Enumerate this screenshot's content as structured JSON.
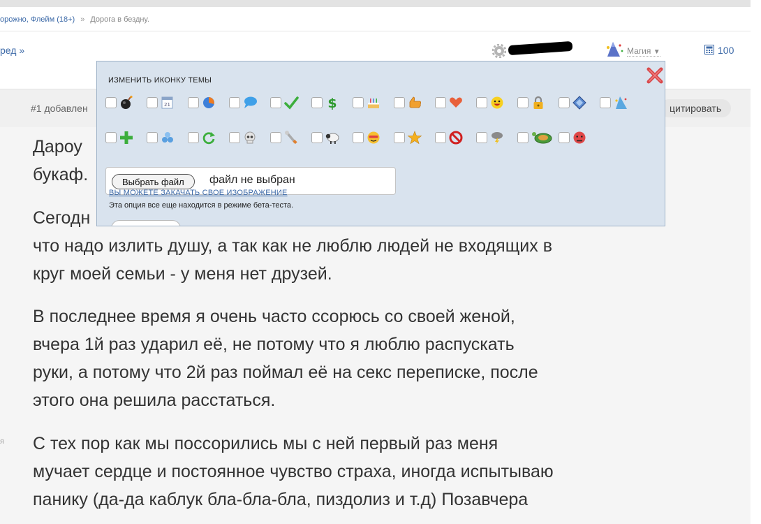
{
  "breadcrumb": {
    "section": "орожно, Флейм (18+)",
    "separator": "»",
    "current": "Дорога в бездну."
  },
  "nav": {
    "next_link": "ред »",
    "user_menu_label": "",
    "magic_label": "Магия",
    "dropdown_arrow": "▼",
    "count": "100"
  },
  "post": {
    "number_text": "#1 добавлен",
    "quote_label": "цитировать",
    "side_hint": "я"
  },
  "paragraphs": [
    {
      "lines": [
        "Дароу",
        "букаф."
      ]
    },
    {
      "lines": [
        "Сегодн",
        "что надо излить душу, а так как не люблю людей не входящих в",
        "круг моей семьи - у меня нет друзей."
      ]
    },
    {
      "lines": [
        "В последнее время я очень часто ссорюсь со своей женой,",
        "вчера 1й раз ударил её, не потому что я люблю распускать",
        "руки, а потому что 2й раз поймал её на секс переписке, после",
        "этого она решила расстаться."
      ]
    },
    {
      "lines": [
        "С тех пор как мы поссорились мы с ней первый раз меня",
        "мучает сердце и постоянное чувство страха, иногда испытываю",
        "панику (да-да каблук бла-бла-бла, пиздолиз и т.д) Позавчера"
      ]
    }
  ],
  "icon_panel": {
    "title": "ИЗМЕНИТЬ ИКОНКУ ТЕМЫ",
    "row1": [
      "bomb-icon",
      "calendar-icon",
      "pie-chart-icon",
      "speech-bubble-icon",
      "checkmark-icon",
      "dollar-icon",
      "cake-icon",
      "thumb-icon",
      "heart-icon",
      "smiley-icon",
      "padlock-icon",
      "diamond-icon",
      "sparkle-icon"
    ],
    "row2": [
      "plus-icon",
      "molecule-icon",
      "refresh-icon",
      "skull-icon",
      "wrench-icon",
      "sheep-icon",
      "cool-face-icon",
      "star-icon",
      "no-entry-icon",
      "storm-cloud-icon",
      "turtle-icon",
      "angry-face-icon"
    ],
    "file_button": "Выбрать файл",
    "file_state": "файл не выбран",
    "upload_link": "ВЫ МОЖЕТЕ ЗАКАЧАТЬ СВОЕ ИЗОБРАЖЕНИЕ",
    "beta_note": "Эта опция все еще находится в режиме бета-теста."
  },
  "colors": {
    "link": "#3d6aa8",
    "panel_bg": "#d9e3ee",
    "close_red": "#d9484a"
  }
}
